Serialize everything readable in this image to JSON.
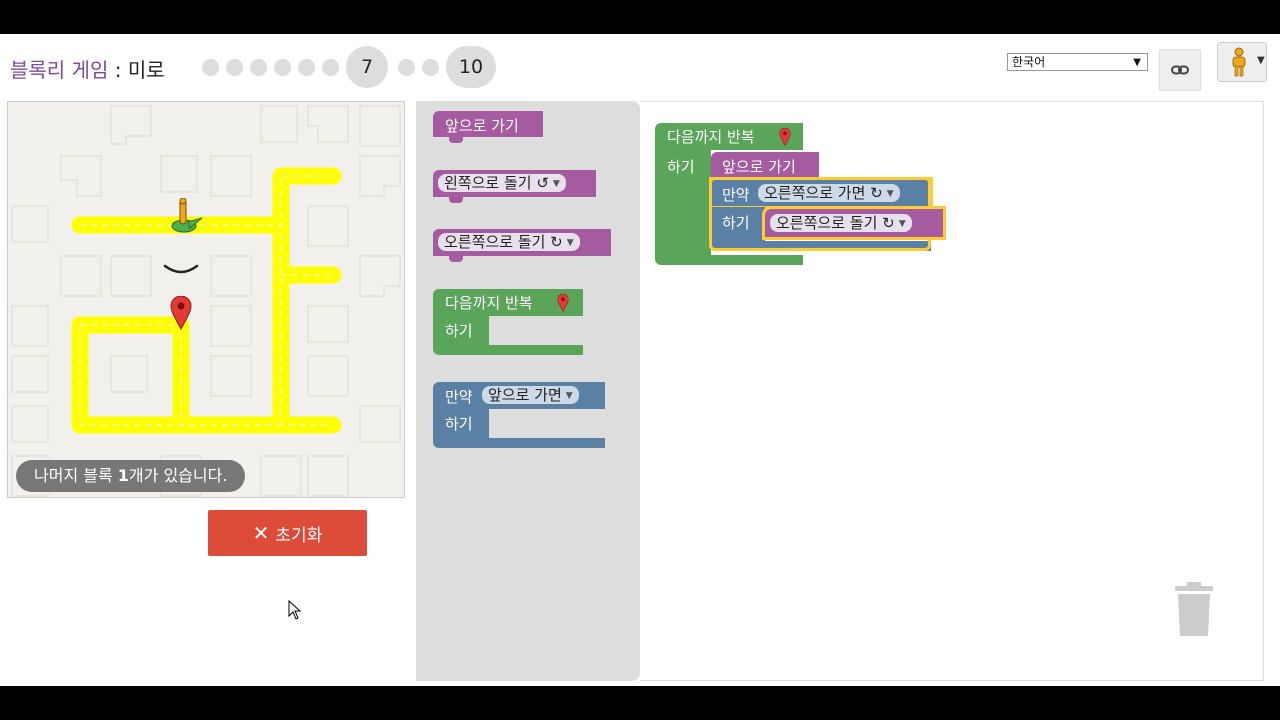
{
  "header": {
    "app_title": "블록리 게임",
    "separator": " : ",
    "game_title": "미로",
    "levels": {
      "current": "7",
      "last": "10"
    }
  },
  "language": {
    "selected": "한국어"
  },
  "maze": {
    "capacity_text_pre": "나머지 블록 ",
    "capacity_count": "1",
    "capacity_text_post": "개가 있습니다."
  },
  "controls": {
    "reset_label": "초기화"
  },
  "toolbox": {
    "move_forward": "앞으로 가기",
    "turn_left": "왼쪽으로 돌기 ↺",
    "turn_right": "오른쪽으로 돌기 ↻",
    "repeat_until": "다음까지 반복",
    "do": "하기",
    "if": "만약",
    "if_path_ahead": "앞으로 가면"
  },
  "workspace": {
    "repeat_until": "다음까지 반복",
    "do": "하기",
    "move_forward": "앞으로 가기",
    "if": "만약",
    "if_path_right": "오른쪽으로 가면 ↻",
    "do_inner": "하기",
    "turn_right": "오른쪽으로 돌기 ↻"
  },
  "colors": {
    "movement": "#a55b9f",
    "loop": "#5ba55b",
    "logic": "#5b80a5",
    "path": "#ffff00",
    "reset": "#dd4b39"
  }
}
